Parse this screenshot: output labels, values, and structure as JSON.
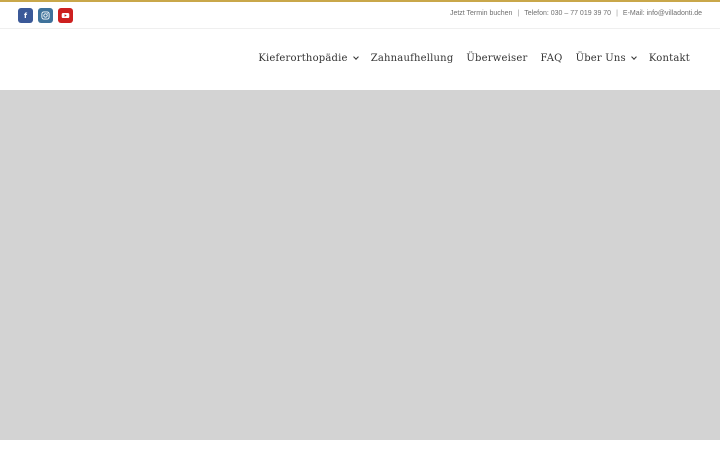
{
  "colors": {
    "accent": "#c9a74a",
    "facebook": "#3b5998",
    "instagram": "#3f729b",
    "youtube": "#cd201f",
    "hero": "#d3d3d3"
  },
  "social": [
    {
      "icon": "facebook-icon",
      "label": "f"
    },
    {
      "icon": "instagram-icon"
    },
    {
      "icon": "youtube-icon"
    }
  ],
  "contact": {
    "booking": "Jetzt Termin buchen",
    "separator": "|",
    "phone": "Telefon: 030 – 77 019 39 70",
    "email": "E-Mail: info@villadonti.de"
  },
  "nav": [
    {
      "label": "Kieferorthopädie",
      "dropdown": true
    },
    {
      "label": "Zahnaufhellung",
      "dropdown": false
    },
    {
      "label": "Überweiser",
      "dropdown": false
    },
    {
      "label": "FAQ",
      "dropdown": false
    },
    {
      "label": "Über Uns",
      "dropdown": true
    },
    {
      "label": "Kontakt",
      "dropdown": false
    }
  ]
}
